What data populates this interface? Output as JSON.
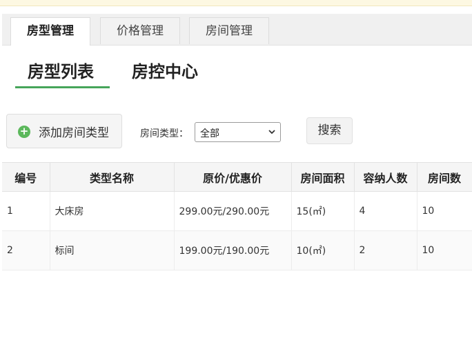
{
  "tabs": [
    {
      "label": "房型管理",
      "active": true
    },
    {
      "label": "价格管理",
      "active": false
    },
    {
      "label": "房间管理",
      "active": false
    }
  ],
  "subnav": {
    "list_label": "房型列表",
    "control_label": "房控中心"
  },
  "toolbar": {
    "add_label": "添加房间类型",
    "filter_label": "房间类型：",
    "filter_value": "全部",
    "search_label": "搜索"
  },
  "table": {
    "headers": [
      "编号",
      "类型名称",
      "原价/优惠价",
      "房间面积",
      "容纳人数",
      "房间数"
    ],
    "rows": [
      [
        "1",
        "大床房",
        "299.00元/290.00元",
        "15(㎡)",
        "4",
        "10"
      ],
      [
        "2",
        "标间",
        "199.00元/190.00元",
        "10(㎡)",
        "2",
        "10"
      ]
    ]
  },
  "colors": {
    "accent": "#46a55a",
    "add_icon": "#5cb85c"
  },
  "icons": {
    "add": "plus-circle-icon",
    "select": "chevron-down-icon"
  }
}
